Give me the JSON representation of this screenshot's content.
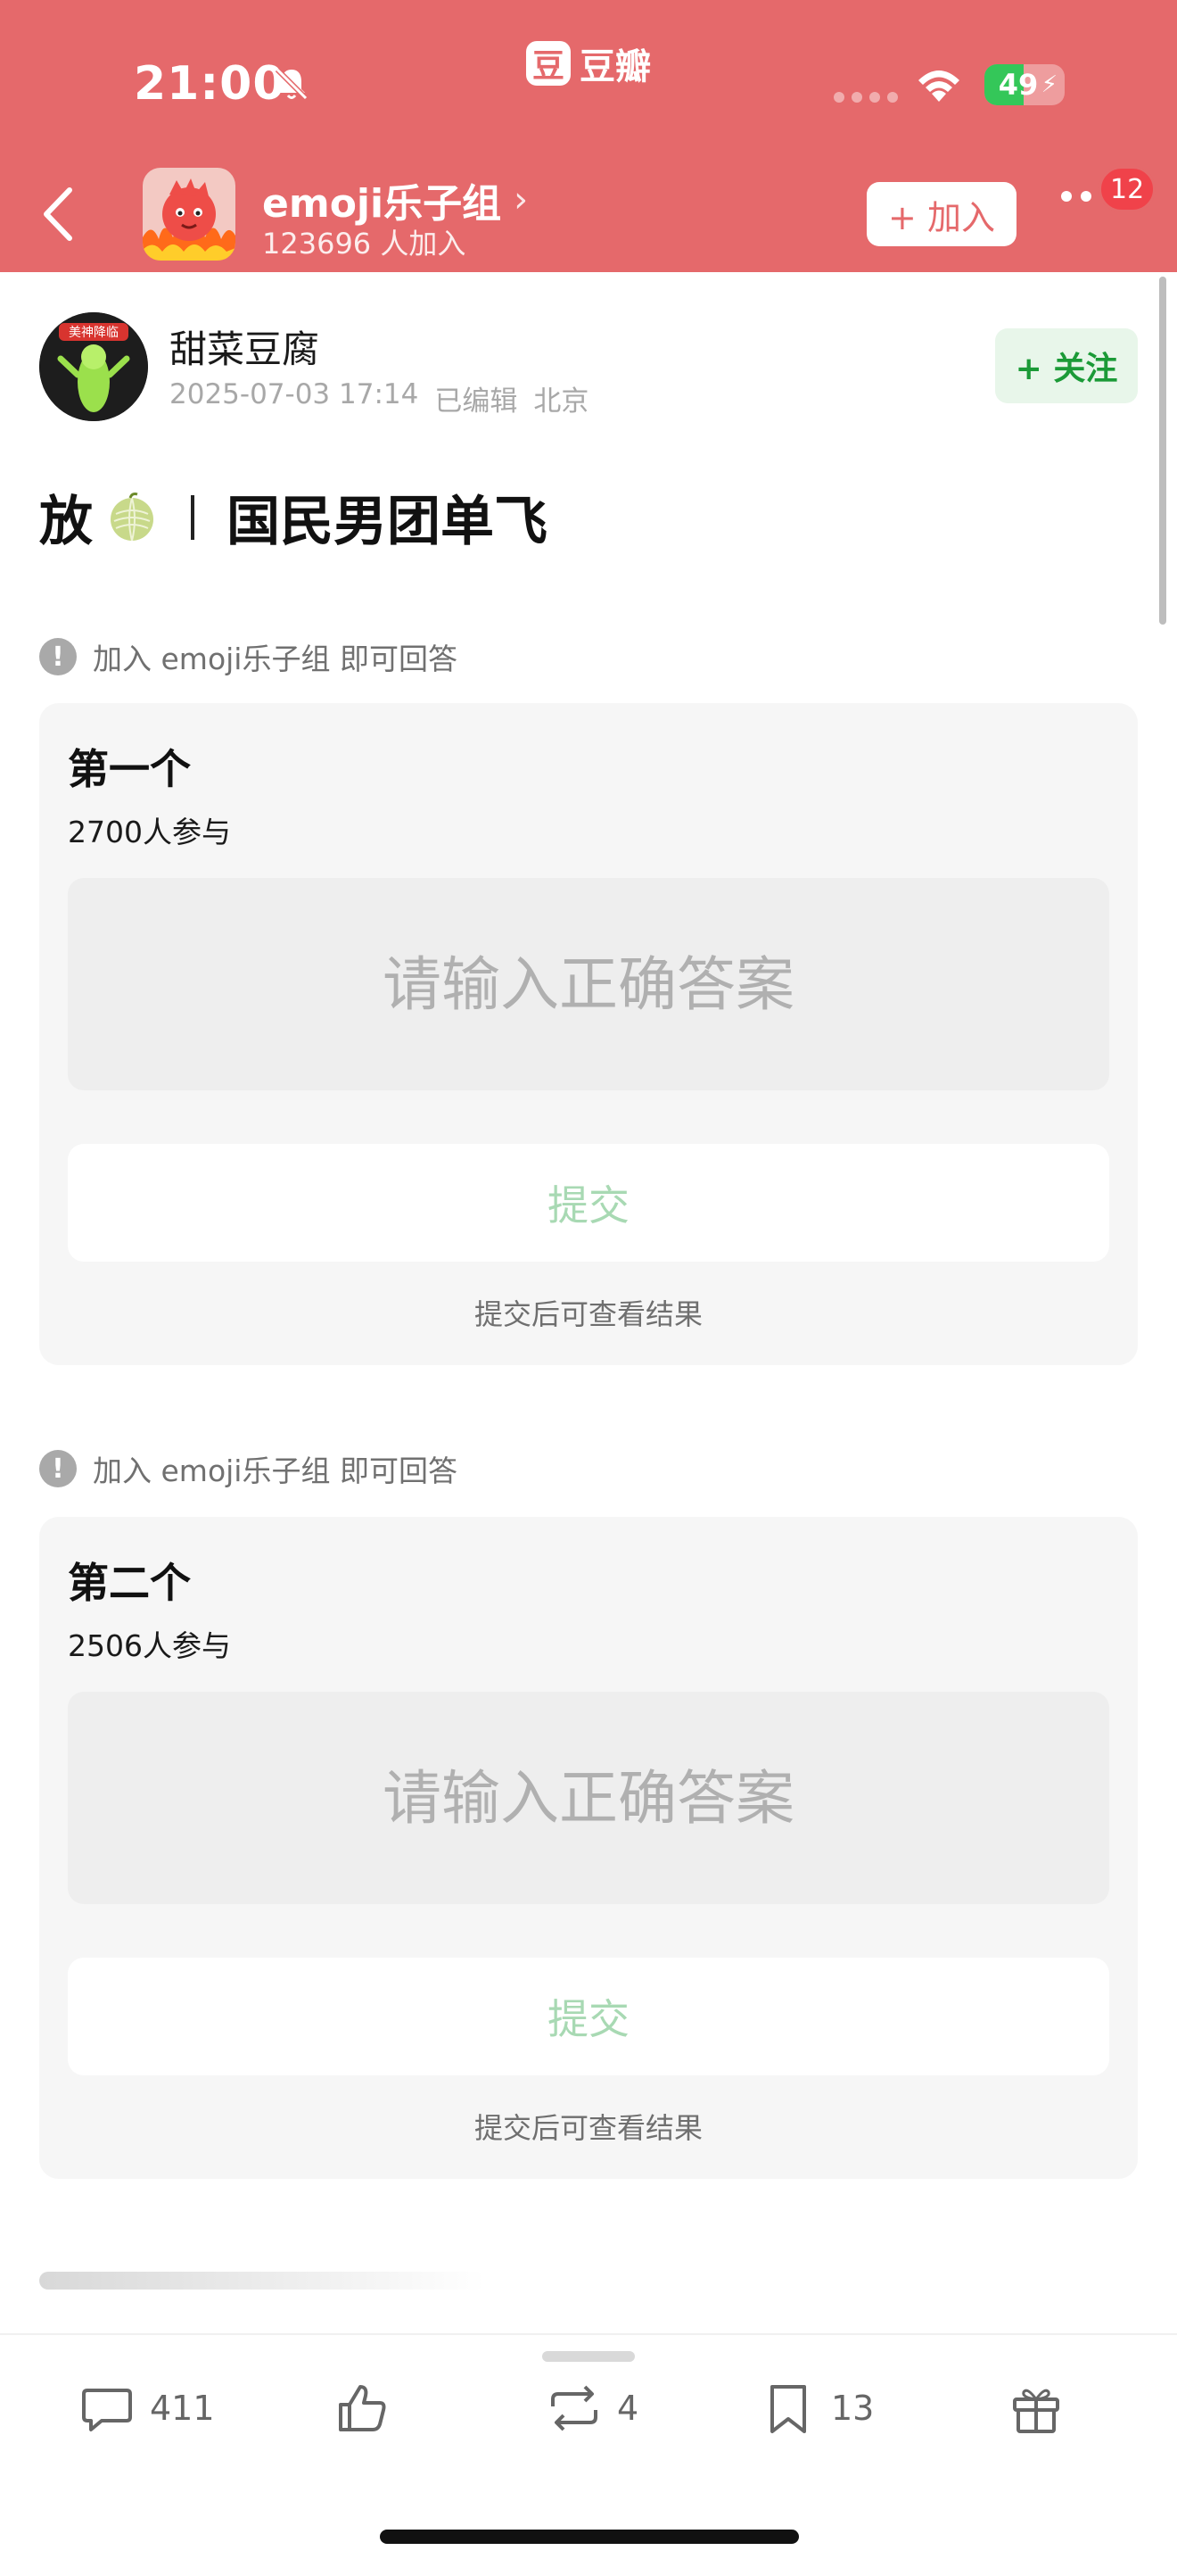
{
  "status_bar": {
    "time": "21:00",
    "battery": "49",
    "battery_level": 0.49,
    "app_logo_char": "豆",
    "app_name": "豆瓣"
  },
  "group": {
    "name": "emoji乐子组",
    "members": "123696 人加入",
    "join_label": "+ 加入",
    "notification_count": "12"
  },
  "post": {
    "author": "甜菜豆腐",
    "avatar_text": "美神降临",
    "date": "2025-07-03 17:14",
    "edited": "已编辑",
    "location": "北京",
    "follow_label": "+ 关注",
    "title_prefix": "放",
    "title_rest": "国民男团单飞"
  },
  "quizzes": [
    {
      "notice": "加入 emoji乐子组 即可回答",
      "title": "第一个",
      "participants": "2700人参与",
      "placeholder": "请输入正确答案",
      "submit_label": "提交",
      "hint": "提交后可查看结果"
    },
    {
      "notice": "加入 emoji乐子组 即可回答",
      "title": "第二个",
      "participants": "2506人参与",
      "placeholder": "请输入正确答案",
      "submit_label": "提交",
      "hint": "提交后可查看结果"
    }
  ],
  "actions": {
    "comments": "411",
    "reposts": "4",
    "collects": "13"
  },
  "colors": {
    "header": "#e5696b",
    "follow_green": "#1b9a37",
    "submit_disabled": "#a8d9b3"
  }
}
